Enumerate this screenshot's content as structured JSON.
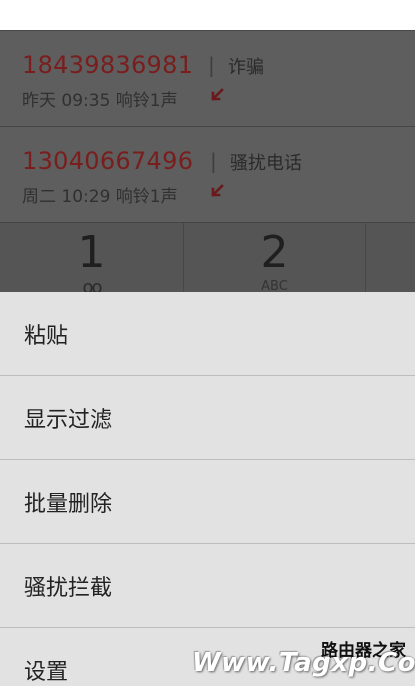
{
  "call_log": [
    {
      "number": "18439836981",
      "tag": "诈骗",
      "time": "昨天 09:35 响铃1声"
    },
    {
      "number": "13040667496",
      "tag": "骚扰电话",
      "time": "周二 10:29 响铃1声"
    }
  ],
  "keypad": [
    {
      "digit": "1",
      "letters": "",
      "voicemail": "oo"
    },
    {
      "digit": "2",
      "letters": "ABC",
      "voicemail": ""
    }
  ],
  "menu": {
    "items": [
      {
        "label": "粘贴"
      },
      {
        "label": "显示过滤"
      },
      {
        "label": "批量删除"
      },
      {
        "label": "骚扰拦截"
      },
      {
        "label": "设置"
      }
    ]
  },
  "watermark": {
    "site_cn": "路由器之家",
    "url": "Www.Tagxp.Com"
  },
  "colors": {
    "missed_call_red": "#7a1d1d",
    "menu_background": "#e2e2e2",
    "divider": "#bdbdbd"
  }
}
